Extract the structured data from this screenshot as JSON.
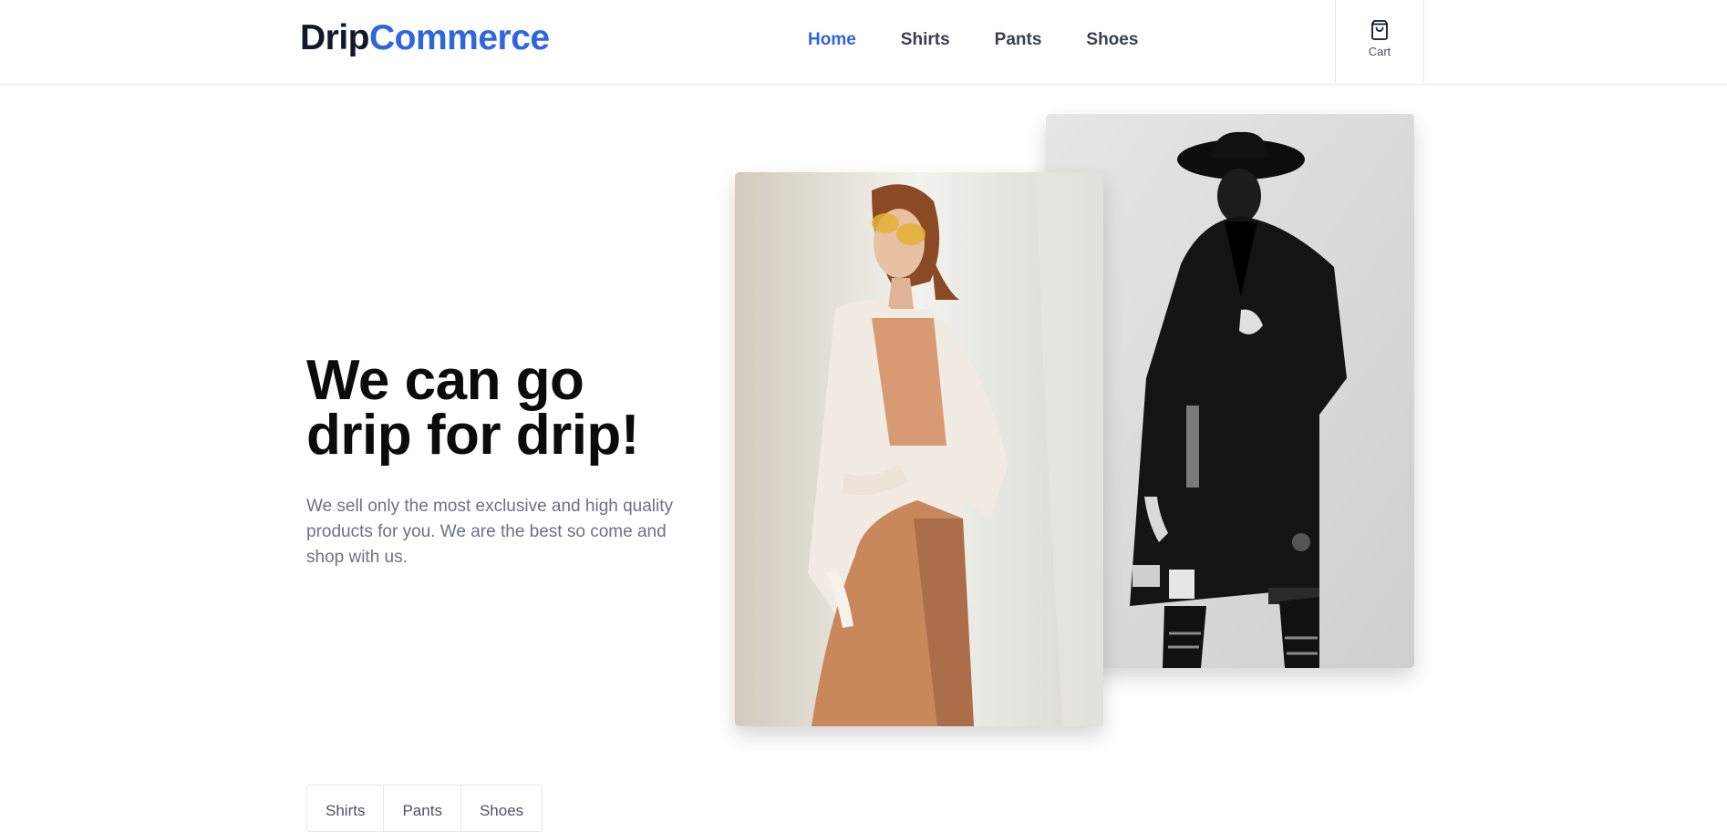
{
  "header": {
    "logo_part1": "Drip",
    "logo_part2": "Commerce",
    "nav": [
      {
        "label": "Home",
        "active": true
      },
      {
        "label": "Shirts",
        "active": false
      },
      {
        "label": "Pants",
        "active": false
      },
      {
        "label": "Shoes",
        "active": false
      }
    ],
    "cart_label": "Cart",
    "cart_icon": "shopping-bag-icon"
  },
  "hero": {
    "title_line1": "We can go",
    "title_line2": "drip for drip!",
    "description": "We sell only the most exclusive and high quality products for you. We are the best so come and shop with us."
  },
  "images": {
    "front": "woman-in-white-shirt-and-sunglasses-photo",
    "back": "man-in-black-coat-and-hat-photo"
  },
  "category_tabs": [
    "Shirts",
    "Pants",
    "Shoes"
  ],
  "colors": {
    "accent": "#2f65e0",
    "text_dark": "#111827",
    "text_muted": "#6b7280",
    "border": "#e5e7eb"
  }
}
